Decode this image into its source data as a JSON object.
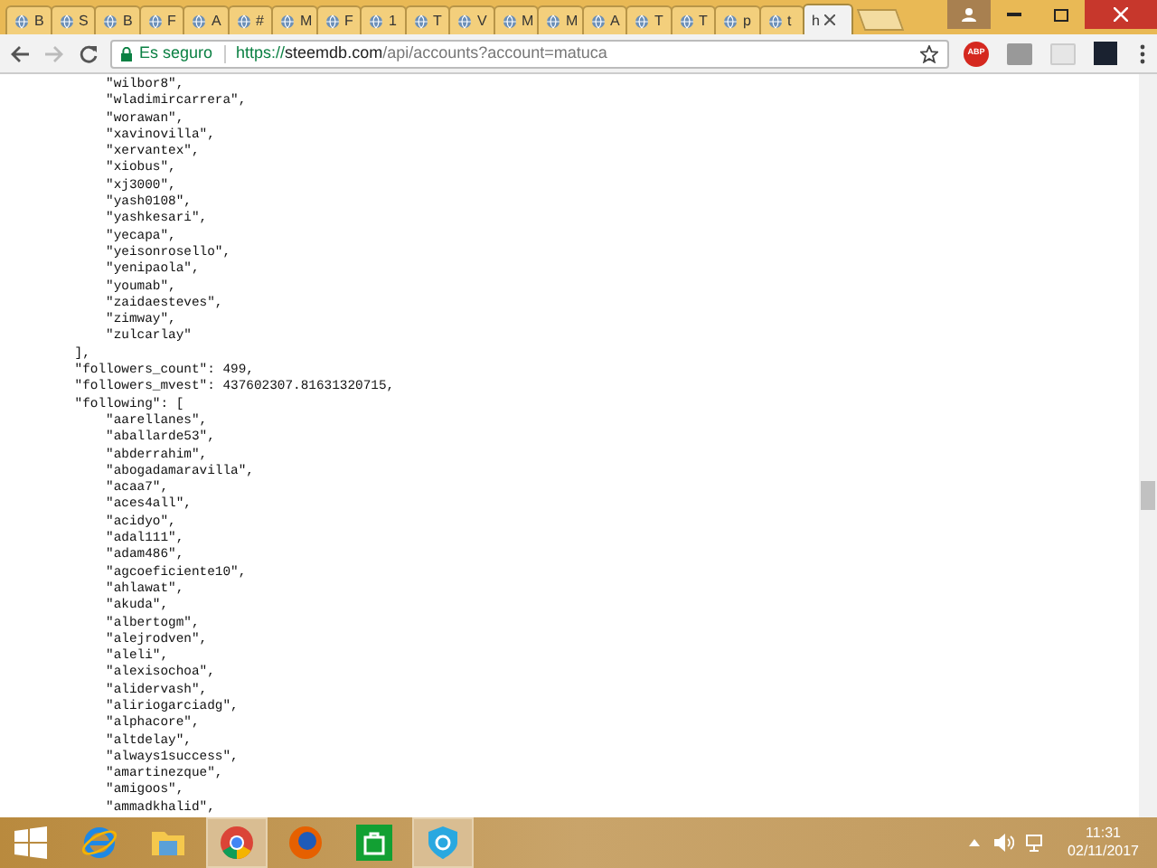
{
  "tabs": [
    {
      "label": "B",
      "selected": false
    },
    {
      "label": "S",
      "selected": false
    },
    {
      "label": "B",
      "selected": false
    },
    {
      "label": "F",
      "selected": false
    },
    {
      "label": "A",
      "selected": false
    },
    {
      "label": "#",
      "selected": false
    },
    {
      "label": "M",
      "selected": false
    },
    {
      "label": "F",
      "selected": false
    },
    {
      "label": "1",
      "selected": false
    },
    {
      "label": "T",
      "selected": false
    },
    {
      "label": "V",
      "selected": false
    },
    {
      "label": "M",
      "selected": false
    },
    {
      "label": "M",
      "selected": false
    },
    {
      "label": "A",
      "selected": false
    },
    {
      "label": "T",
      "selected": false
    },
    {
      "label": "T",
      "selected": false
    },
    {
      "label": "p",
      "selected": false
    },
    {
      "label": "t",
      "selected": false
    },
    {
      "label": "h",
      "selected": true
    }
  ],
  "address_bar": {
    "security": "Es seguro",
    "url_scheme": "https://",
    "url_host": "steemdb.com",
    "url_path": "/api/accounts?account=matuca"
  },
  "extensions": {
    "abp_label": "ABP"
  },
  "document": {
    "lines": [
      "        \"wilbor8\",",
      "        \"wladimircarrera\",",
      "        \"worawan\",",
      "        \"xavinovilla\",",
      "        \"xervantex\",",
      "        \"xiobus\",",
      "        \"xj3000\",",
      "        \"yash0108\",",
      "        \"yashkesari\",",
      "        \"yecapa\",",
      "        \"yeisonrosello\",",
      "        \"yenipaola\",",
      "        \"youmab\",",
      "        \"zaidaesteves\",",
      "        \"zimway\",",
      "        \"zulcarlay\"",
      "    ],",
      "    \"followers_count\": 499,",
      "    \"followers_mvest\": 437602307.81631320715,",
      "    \"following\": [",
      "        \"aarellanes\",",
      "        \"aballarde53\",",
      "        \"abderrahim\",",
      "        \"abogadamaravilla\",",
      "        \"acaa7\",",
      "        \"aces4all\",",
      "        \"acidyo\",",
      "        \"adal111\",",
      "        \"adam486\",",
      "        \"agcoeficiente10\",",
      "        \"ahlawat\",",
      "        \"akuda\",",
      "        \"albertogm\",",
      "        \"alejrodven\",",
      "        \"aleli\",",
      "        \"alexisochoa\",",
      "        \"alidervash\",",
      "        \"aliriogarciadg\",",
      "        \"alphacore\",",
      "        \"altdelay\",",
      "        \"always1success\",",
      "        \"amartinezque\",",
      "        \"amigoos\",",
      "        \"ammadkhalid\","
    ]
  },
  "taskbar": {
    "apps": [
      {
        "kind": "start",
        "selected": false
      },
      {
        "kind": "ie",
        "selected": false
      },
      {
        "kind": "explorer",
        "selected": false
      },
      {
        "kind": "chrome",
        "selected": true
      },
      {
        "kind": "firefox",
        "selected": false
      },
      {
        "kind": "store",
        "selected": false
      },
      {
        "kind": "shield",
        "selected": true
      }
    ],
    "time": "11:31",
    "date": "02/11/2017"
  }
}
